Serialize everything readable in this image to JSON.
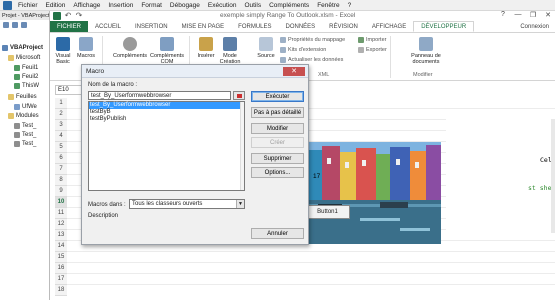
{
  "vbe_menu": {
    "items": [
      "Fichier",
      "Edition",
      "Affichage",
      "Insertion",
      "Format",
      "Débogage",
      "Exécution",
      "Outils",
      "Compléments",
      "Fenêtre",
      "?"
    ]
  },
  "excel_title": "exemple simply Range To Outlook.xlsm - Excel",
  "window_controls": [
    "?",
    "—",
    "❐",
    "✕"
  ],
  "ribbon_tabs": [
    "FICHIER",
    "ACCUEIL",
    "INSERTION",
    "MISE EN PAGE",
    "FORMULES",
    "DONNÉES",
    "RÉVISION",
    "AFFICHAGE",
    "DÉVELOPPEUR"
  ],
  "active_tab": "DÉVELOPPEUR",
  "connexion": "Connexion",
  "ribbon": {
    "visual_basic": "Visual Basic",
    "macros": "Macros",
    "complements": "Compléments",
    "complements_com": "Compléments COM",
    "inserer": "Insérer",
    "mode": "Mode Création",
    "source": "Source",
    "proprietes_mappage": "Propriétés du mappage",
    "kits_extension": "Kits d'extension",
    "actualiser_donnees": "Actualiser les données",
    "importer": "Importer",
    "exporter": "Exporter",
    "panneau_documents": "Panneau de documents",
    "group_xml": "XML",
    "group_modifier": "Modifier"
  },
  "vbe_pane": {
    "title": "Projet - VBAProject",
    "tree": [
      {
        "label": "VBAProject",
        "level": 0
      },
      {
        "label": "Microsoft",
        "level": 1
      },
      {
        "label": "Feuil1",
        "level": 2
      },
      {
        "label": "Feuil2",
        "level": 2
      },
      {
        "label": "ThisW",
        "level": 2
      },
      {
        "label": "Feuilles",
        "level": 1
      },
      {
        "label": "UfWe",
        "level": 2
      },
      {
        "label": "Modules",
        "level": 1
      },
      {
        "label": "Test_",
        "level": 2
      },
      {
        "label": "Test_",
        "level": 2
      },
      {
        "label": "Test_",
        "level": 2
      }
    ]
  },
  "name_box": "E10",
  "row_headers": [
    "1",
    "2",
    "3",
    "4",
    "5",
    "6",
    "7",
    "8",
    "9",
    "10",
    "11",
    "12",
    "13",
    "14",
    "15",
    "16",
    "17",
    "18"
  ],
  "selected_row": "10",
  "sheet": {
    "photo_text": "17",
    "button_label": "Button1"
  },
  "code": {
    "line1": "Cel, AddR",
    "line2": "st sheet te"
  },
  "dialog": {
    "title": "Macro",
    "close": "✕",
    "name_label": "Nom de la macro :",
    "name_value": "test_By_Userformwebbrowser",
    "macros": [
      "test_By_Userformwebbrowser",
      "testByB",
      "testByPublish"
    ],
    "selected_macro": "test_By_Userformwebbrowser",
    "buttons": {
      "executer": "Exécuter",
      "pas_a_pas": "Pas à pas détaillé",
      "modifier": "Modifier",
      "creer": "Créer",
      "supprimer": "Supprimer",
      "options": "Options...",
      "annuler": "Annuler"
    },
    "macros_in_label": "Macros dans :",
    "macros_in_value": "Tous les classeurs ouverts",
    "description_label": "Description"
  }
}
